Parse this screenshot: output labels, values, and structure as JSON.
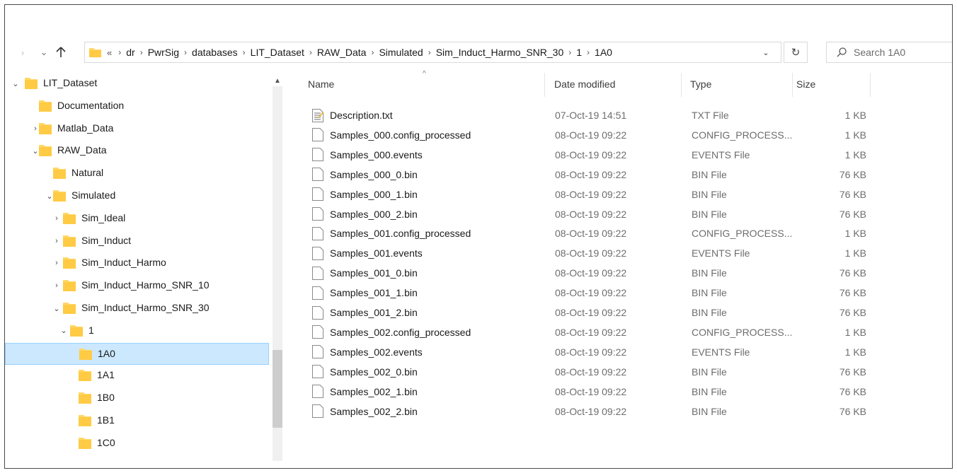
{
  "address_bar": {
    "overflow": "«",
    "crumbs": [
      "dr",
      "PwrSig",
      "databases",
      "LIT_Dataset",
      "RAW_Data",
      "Simulated",
      "Sim_Induct_Harmo_SNR_30",
      "1",
      "1A0"
    ],
    "dropdown": "⌄",
    "refresh": "↻"
  },
  "search": {
    "placeholder": "Search 1A0"
  },
  "nav_tree": [
    {
      "label": "LIT_Dataset",
      "level": 0,
      "chevron": "⌄"
    },
    {
      "label": "Documentation",
      "level": 1,
      "chevron": ""
    },
    {
      "label": "Matlab_Data",
      "level": 1,
      "chevron": "›"
    },
    {
      "label": "RAW_Data",
      "level": 1,
      "chevron": "⌄"
    },
    {
      "label": "Natural",
      "level": 2,
      "chevron": ""
    },
    {
      "label": "Simulated",
      "level": 2,
      "chevron": "⌄"
    },
    {
      "label": "Sim_Ideal",
      "level": 3,
      "chevron": "›"
    },
    {
      "label": "Sim_Induct",
      "level": 3,
      "chevron": "›"
    },
    {
      "label": "Sim_Induct_Harmo",
      "level": 3,
      "chevron": "›"
    },
    {
      "label": "Sim_Induct_Harmo_SNR_10",
      "level": 3,
      "chevron": "›"
    },
    {
      "label": "Sim_Induct_Harmo_SNR_30",
      "level": 3,
      "chevron": "⌄"
    },
    {
      "label": "1",
      "level": 4,
      "chevron": "⌄"
    },
    {
      "label": "1A0",
      "level": 5,
      "chevron": "",
      "selected": true
    },
    {
      "label": "1A1",
      "level": 5,
      "chevron": ""
    },
    {
      "label": "1B0",
      "level": 5,
      "chevron": ""
    },
    {
      "label": "1B1",
      "level": 5,
      "chevron": ""
    },
    {
      "label": "1C0",
      "level": 5,
      "chevron": ""
    }
  ],
  "columns": {
    "name": "Name",
    "date": "Date modified",
    "type": "Type",
    "size": "Size"
  },
  "files": [
    {
      "name": "Description.txt",
      "date": "07-Oct-19 14:51",
      "type": "TXT File",
      "size": "1 KB",
      "icon": "text-file-icon"
    },
    {
      "name": "Samples_000.config_processed",
      "date": "08-Oct-19 09:22",
      "type": "CONFIG_PROCESS...",
      "size": "1 KB",
      "icon": "file-icon"
    },
    {
      "name": "Samples_000.events",
      "date": "08-Oct-19 09:22",
      "type": "EVENTS File",
      "size": "1 KB",
      "icon": "file-icon"
    },
    {
      "name": "Samples_000_0.bin",
      "date": "08-Oct-19 09:22",
      "type": "BIN File",
      "size": "76 KB",
      "icon": "file-icon"
    },
    {
      "name": "Samples_000_1.bin",
      "date": "08-Oct-19 09:22",
      "type": "BIN File",
      "size": "76 KB",
      "icon": "file-icon"
    },
    {
      "name": "Samples_000_2.bin",
      "date": "08-Oct-19 09:22",
      "type": "BIN File",
      "size": "76 KB",
      "icon": "file-icon"
    },
    {
      "name": "Samples_001.config_processed",
      "date": "08-Oct-19 09:22",
      "type": "CONFIG_PROCESS...",
      "size": "1 KB",
      "icon": "file-icon"
    },
    {
      "name": "Samples_001.events",
      "date": "08-Oct-19 09:22",
      "type": "EVENTS File",
      "size": "1 KB",
      "icon": "file-icon"
    },
    {
      "name": "Samples_001_0.bin",
      "date": "08-Oct-19 09:22",
      "type": "BIN File",
      "size": "76 KB",
      "icon": "file-icon"
    },
    {
      "name": "Samples_001_1.bin",
      "date": "08-Oct-19 09:22",
      "type": "BIN File",
      "size": "76 KB",
      "icon": "file-icon"
    },
    {
      "name": "Samples_001_2.bin",
      "date": "08-Oct-19 09:22",
      "type": "BIN File",
      "size": "76 KB",
      "icon": "file-icon"
    },
    {
      "name": "Samples_002.config_processed",
      "date": "08-Oct-19 09:22",
      "type": "CONFIG_PROCESS...",
      "size": "1 KB",
      "icon": "file-icon"
    },
    {
      "name": "Samples_002.events",
      "date": "08-Oct-19 09:22",
      "type": "EVENTS File",
      "size": "1 KB",
      "icon": "file-icon"
    },
    {
      "name": "Samples_002_0.bin",
      "date": "08-Oct-19 09:22",
      "type": "BIN File",
      "size": "76 KB",
      "icon": "file-icon"
    },
    {
      "name": "Samples_002_1.bin",
      "date": "08-Oct-19 09:22",
      "type": "BIN File",
      "size": "76 KB",
      "icon": "file-icon"
    },
    {
      "name": "Samples_002_2.bin",
      "date": "08-Oct-19 09:22",
      "type": "BIN File",
      "size": "76 KB",
      "icon": "file-icon"
    }
  ],
  "colors": {
    "folder": "#ffd766",
    "selection": "#cce8ff",
    "selection_border": "#99d1ff"
  }
}
